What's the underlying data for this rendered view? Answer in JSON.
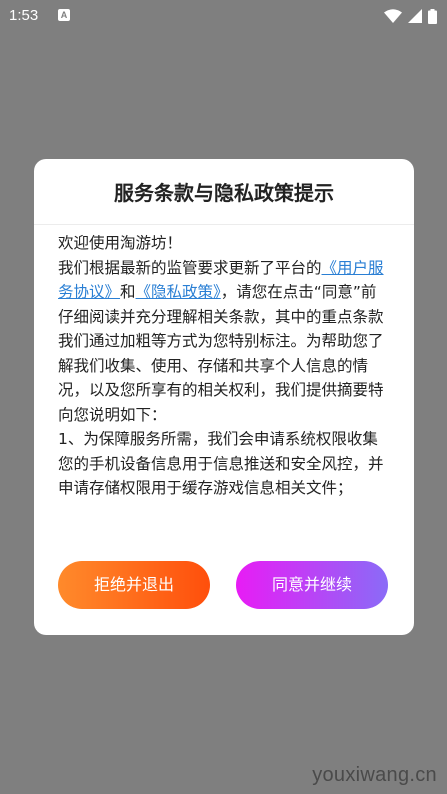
{
  "status_bar": {
    "time": "1:53",
    "notification_icon_letter": "A",
    "icons": [
      "wifi-icon",
      "signal-icon",
      "battery-icon"
    ]
  },
  "dialog": {
    "title": "服务条款与隐私政策提示",
    "greeting": "欢迎使用淘游坊！",
    "text_1": "我们根据最新的监管要求更新了平台的",
    "link_terms": "《用户服务协议》",
    "text_and": "和",
    "link_privacy": "《隐私政策》",
    "text_2": "，请您在点击“同意”前仔细阅读并充分理解相关条款，其中的重点条款我们通过加粗等方式为您特别标注。为帮助您了解我们收集、使用、存储和共享个人信息的情况，以及您所享有的相关权利，我们提供摘要特向您说明如下：",
    "item_1": "1、为保障服务所需，我们会申请系统权限收集您的手机设备信息用于信息推送和安全风控，并申请存储权限用于缓存游戏信息相关文件；",
    "reject_button": "拒绝并退出",
    "agree_button": "同意并继续"
  },
  "watermark": "youxiwang.cn",
  "colors": {
    "overlay": "#7f7f7f",
    "link": "#2a7fd4",
    "reject_gradient": [
      "#ff8a2b",
      "#ff4f0c"
    ],
    "agree_gradient": [
      "#e81cf5",
      "#8a6bf7"
    ]
  }
}
